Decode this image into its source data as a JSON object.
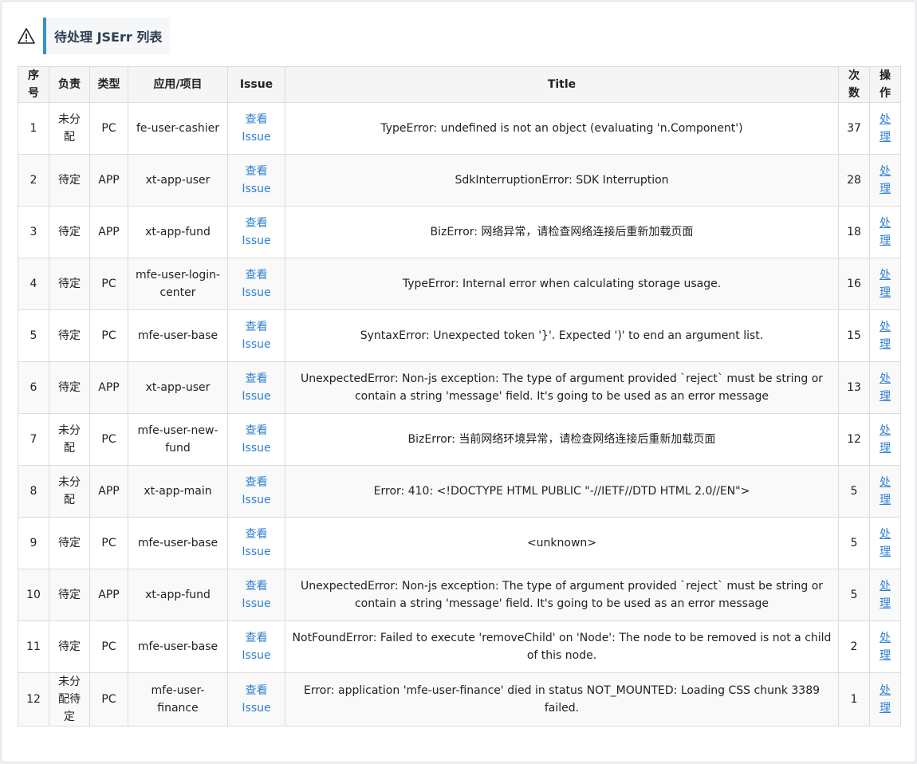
{
  "header": {
    "icon": "warning-icon",
    "title": "待处理 JSErr 列表"
  },
  "table": {
    "columns": [
      "序号",
      "负责",
      "类型",
      "应用/项目",
      "Issue",
      "Title",
      "次数",
      "操作"
    ],
    "rows": [
      {
        "idx": "1",
        "owner": "未分配",
        "type": "PC",
        "app": "fe-user-cashier",
        "issue": "查看 Issue",
        "title": "TypeError: undefined is not an object (evaluating 'n.Component')",
        "count": "37",
        "action": "处理"
      },
      {
        "idx": "2",
        "owner": "待定",
        "type": "APP",
        "app": "xt-app-user",
        "issue": "查看 Issue",
        "title": "SdkInterruptionError: SDK Interruption",
        "count": "28",
        "action": "处理"
      },
      {
        "idx": "3",
        "owner": "待定",
        "type": "APP",
        "app": "xt-app-fund",
        "issue": "查看 Issue",
        "title": "BizError: 网络异常，请检查网络连接后重新加载页面",
        "count": "18",
        "action": "处理"
      },
      {
        "idx": "4",
        "owner": "待定",
        "type": "PC",
        "app": "mfe-user-login-center",
        "issue": "查看 Issue",
        "title": "TypeError: Internal error when calculating storage usage.",
        "count": "16",
        "action": "处理"
      },
      {
        "idx": "5",
        "owner": "待定",
        "type": "PC",
        "app": "mfe-user-base",
        "issue": "查看 Issue",
        "title": "SyntaxError: Unexpected token '}'. Expected ')' to end an argument list.",
        "count": "15",
        "action": "处理"
      },
      {
        "idx": "6",
        "owner": "待定",
        "type": "APP",
        "app": "xt-app-user",
        "issue": "查看 Issue",
        "title": "UnexpectedError: Non-js exception: The type of argument provided `reject` must be string or contain a string 'message' field. It's going to be used as an error message",
        "count": "13",
        "action": "处理"
      },
      {
        "idx": "7",
        "owner": "未分配",
        "type": "PC",
        "app": "mfe-user-new-fund",
        "issue": "查看 Issue",
        "title": "BizError: 当前网络环境异常，请检查网络连接后重新加载页面",
        "count": "12",
        "action": "处理"
      },
      {
        "idx": "8",
        "owner": "未分配",
        "type": "APP",
        "app": "xt-app-main",
        "issue": "查看 Issue",
        "title": "Error: 410: <!DOCTYPE HTML PUBLIC \"-//IETF//DTD HTML 2.0//EN\">",
        "count": "5",
        "action": "处理"
      },
      {
        "idx": "9",
        "owner": "待定",
        "type": "PC",
        "app": "mfe-user-base",
        "issue": "查看 Issue",
        "title": "<unknown>",
        "count": "5",
        "action": "处理"
      },
      {
        "idx": "10",
        "owner": "待定",
        "type": "APP",
        "app": "xt-app-fund",
        "issue": "查看 Issue",
        "title": "UnexpectedError: Non-js exception: The type of argument provided `reject` must be string or contain a string 'message' field. It's going to be used as an error message",
        "count": "5",
        "action": "处理"
      },
      {
        "idx": "11",
        "owner": "待定",
        "type": "PC",
        "app": "mfe-user-base",
        "issue": "查看 Issue",
        "title": "NotFoundError: Failed to execute 'removeChild' on 'Node': The node to be removed is not a child of this node.",
        "count": "2",
        "action": "处理"
      },
      {
        "idx": "12",
        "owner": "未分配待定",
        "type": "PC",
        "app": "mfe-user-finance",
        "issue": "查看 Issue",
        "title": "Error: application 'mfe-user-finance' died in status NOT_MOUNTED: Loading CSS chunk 3389 failed.",
        "count": "1",
        "action": "处理"
      }
    ]
  }
}
